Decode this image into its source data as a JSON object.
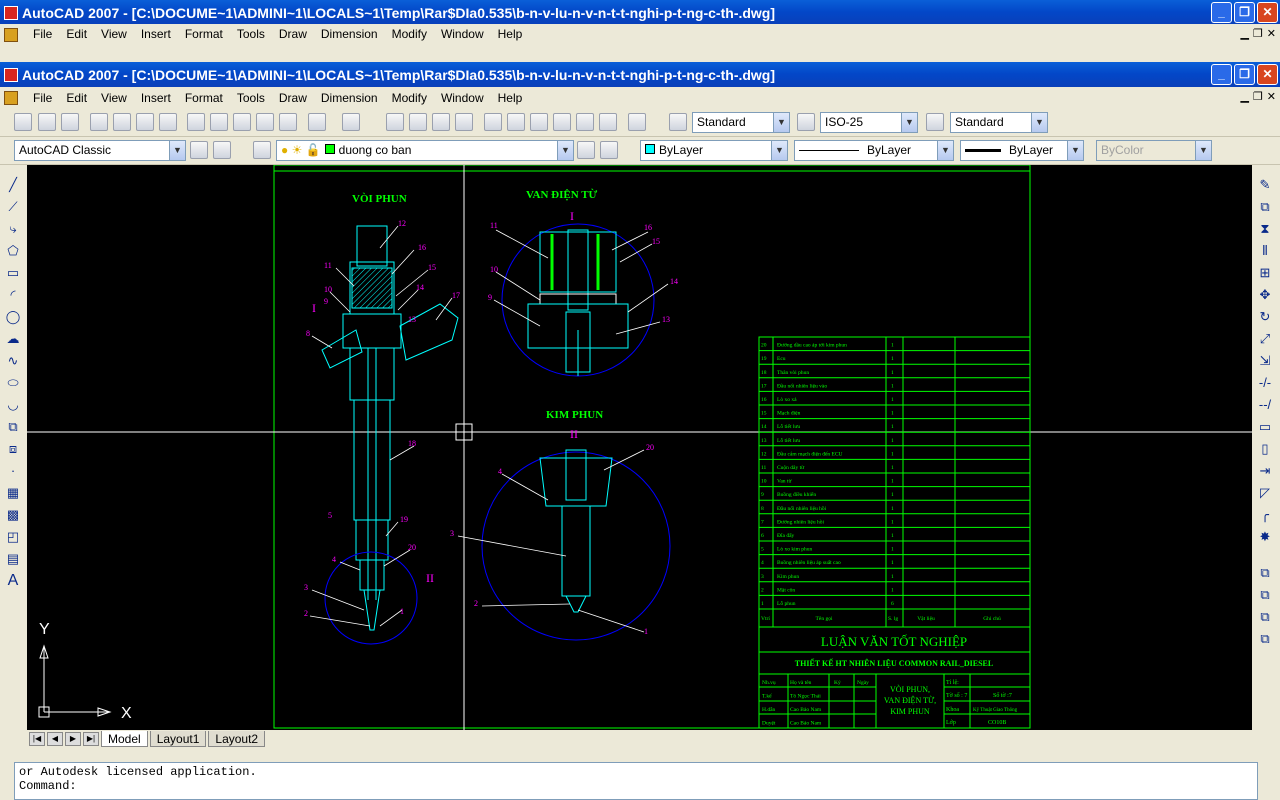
{
  "outer_window": {
    "title": "AutoCAD 2007 - [C:\\DOCUME~1\\ADMINI~1\\LOCALS~1\\Temp\\Rar$DIa0.535\\b-n-v-lu-n-v-n-t-t-nghi-p-t-ng-c-th-.dwg]"
  },
  "window": {
    "title": "AutoCAD 2007 - [C:\\DOCUME~1\\ADMINI~1\\LOCALS~1\\Temp\\Rar$DIa0.535\\b-n-v-lu-n-v-n-t-t-nghi-p-t-ng-c-th-.dwg]"
  },
  "menu": [
    "File",
    "Edit",
    "View",
    "Insert",
    "Format",
    "Tools",
    "Draw",
    "Dimension",
    "Modify",
    "Window",
    "Help"
  ],
  "styles": {
    "text_style": "Standard",
    "dim_style": "ISO-25",
    "table_style": "Standard"
  },
  "workspace": "AutoCAD Classic",
  "layer": "duong co ban",
  "properties": {
    "color": "ByLayer",
    "linetype": "ByLayer",
    "lineweight": "ByLayer",
    "plotstyle": "ByColor"
  },
  "tabs": [
    "Model",
    "Layout1",
    "Layout2"
  ],
  "command": {
    "line1": "or Autodesk licensed application.",
    "line2": "Command:"
  },
  "drawing": {
    "label_injector": "VÒI PHUN",
    "label_valve": "VAN ĐIỆN TỪ",
    "label_needle": "KIM PHUN",
    "mark_I": "I",
    "mark_II": "II",
    "axis_x": "X",
    "axis_y": "Y",
    "title_main": "LUẬN VĂN TỐT NGHIỆP",
    "title_sub": "THIẾT KẾ HT NHIÊN LIỆU COMMON RAIL_DIESEL",
    "title_part": [
      "VÒI PHUN,",
      "VAN ĐIỆN TỪ,",
      "KIM PHUN"
    ],
    "bom": [
      {
        "n": "20",
        "name": "Đường dầu cao áp tới kim phun",
        "q": "1"
      },
      {
        "n": "19",
        "name": "Ecu",
        "q": "1"
      },
      {
        "n": "18",
        "name": "Thân vòi phun",
        "q": "1"
      },
      {
        "n": "17",
        "name": "Đầu nối nhiên liệu vào",
        "q": "1"
      },
      {
        "n": "16",
        "name": "Lò xo xả",
        "q": "1"
      },
      {
        "n": "15",
        "name": "Mạch điện",
        "q": "1"
      },
      {
        "n": "14",
        "name": "Lỗ tiết lưu",
        "q": "1"
      },
      {
        "n": "13",
        "name": "Lỗ tiết lưu",
        "q": "1"
      },
      {
        "n": "12",
        "name": "Đầu cắm mạch điện đến ECU",
        "q": "1"
      },
      {
        "n": "11",
        "name": "Cuộn dây từ",
        "q": "1"
      },
      {
        "n": "10",
        "name": "Van từ",
        "q": "1"
      },
      {
        "n": "9",
        "name": "Buồng điều khiển",
        "q": "1"
      },
      {
        "n": "8",
        "name": "Đầu nối nhiên liệu hồi",
        "q": "1"
      },
      {
        "n": "7",
        "name": "Đường nhiên liệu hồi",
        "q": "1"
      },
      {
        "n": "6",
        "name": "Đĩa đẩy",
        "q": "1"
      },
      {
        "n": "5",
        "name": "Lò xo kim phun",
        "q": "1"
      },
      {
        "n": "4",
        "name": "Buồng nhiên liệu áp suất cao",
        "q": "1"
      },
      {
        "n": "3",
        "name": "Kim phun",
        "q": "1"
      },
      {
        "n": "2",
        "name": "Mặt côn",
        "q": "1"
      },
      {
        "n": "1",
        "name": "Lỗ phun",
        "q": "6"
      }
    ],
    "bom_head": {
      "n": "Vtrí",
      "name": "Tên gọi",
      "q": "S. lg",
      "mat": "Vật liệu",
      "note": "Ghi chú"
    },
    "sign_rows": [
      {
        "role": "Nh.vụ",
        "name": "Họ và tên",
        "sig": "Ký",
        "date": "Ngày"
      },
      {
        "role": "T.kế",
        "name": "Tô Ngọc Thái",
        "sig": "",
        "date": ""
      },
      {
        "role": "H.dẫn",
        "name": "Cao Bảo Nam",
        "sig": "",
        "date": ""
      },
      {
        "role": "Duyệt",
        "name": "Cao Bảo Nam",
        "sig": "",
        "date": ""
      }
    ],
    "info": {
      "tile_label": "Tỉ lệ:",
      "sheet": "Tờ số : 7",
      "sheets": "Số tờ :7",
      "khoa_label": "Khoa",
      "khoa": "Kỹ Thuật Giao Thông",
      "lop_label": "Lớp",
      "lop": "CO10B"
    }
  },
  "colors": {
    "bg": "#000000",
    "frame": "#00ff00",
    "part": "#00ffff",
    "circle": "#0000ff",
    "leader": "#ffffff",
    "callout": "#ff00ff",
    "title": "#00ff00"
  }
}
